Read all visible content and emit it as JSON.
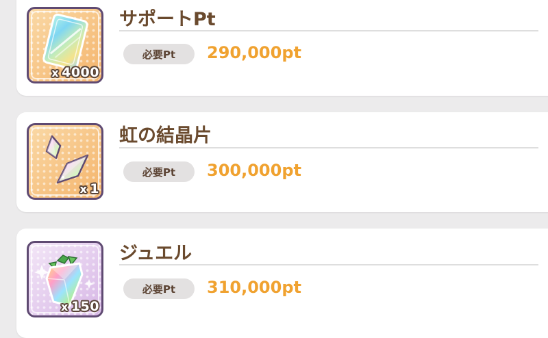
{
  "items": [
    {
      "name": "サポートPt",
      "icon": "support-pt-card-icon",
      "quantity_prefix": "x",
      "quantity": "4000",
      "required_label": "必要Pt",
      "cost": "290,000pt"
    },
    {
      "name": "虹の結晶片",
      "icon": "rainbow-crystal-shard-icon",
      "quantity_prefix": "x",
      "quantity": "1",
      "required_label": "必要Pt",
      "cost": "300,000pt"
    },
    {
      "name": "ジュエル",
      "icon": "jewel-icon",
      "quantity_prefix": "x",
      "quantity": "150",
      "required_label": "必要Pt",
      "cost": "310,000pt"
    }
  ],
  "colors": {
    "title": "#6a4a2e",
    "cost": "#f0a230",
    "pill_bg": "#e3e1e1",
    "frame_border": "#5f4a72"
  }
}
